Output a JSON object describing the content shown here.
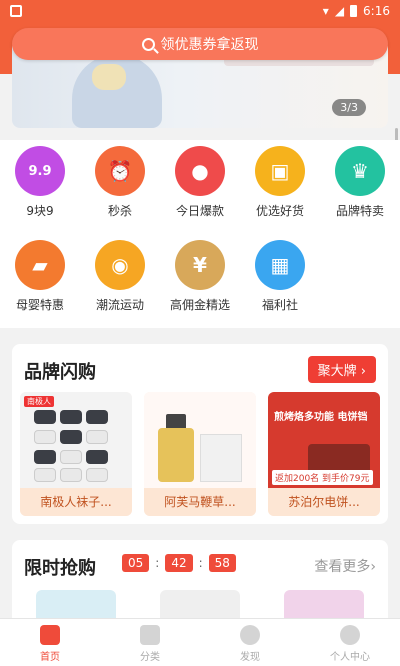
{
  "status_bar": {
    "time": "6:16"
  },
  "search": {
    "placeholder": "领优惠券拿返现"
  },
  "banner": {
    "pager": "3/3"
  },
  "categories": [
    {
      "label": "9块9",
      "icon": "nine-nine-icon",
      "color": "#c14de4",
      "glyph": "9.9"
    },
    {
      "label": "秒杀",
      "icon": "alarm-clock-icon",
      "color": "#f46a3c",
      "glyph": "⏰"
    },
    {
      "label": "今日爆款",
      "icon": "flame-icon",
      "color": "#ef4b4b",
      "glyph": "●"
    },
    {
      "label": "优选好货",
      "icon": "shopping-bag-icon",
      "color": "#f6b21c",
      "glyph": "▣"
    },
    {
      "label": "品牌特卖",
      "icon": "crown-icon",
      "color": "#23c2a0",
      "glyph": "♛"
    },
    {
      "label": "母婴特惠",
      "icon": "baby-bottle-icon",
      "color": "#f37a2f",
      "glyph": "▰"
    },
    {
      "label": "潮流运动",
      "icon": "basketball-icon",
      "color": "#f6a623",
      "glyph": "◉"
    },
    {
      "label": "高佣金精选",
      "icon": "money-bag-icon",
      "color": "#d8a85a",
      "glyph": "¥"
    },
    {
      "label": "福利社",
      "icon": "gift-box-icon",
      "color": "#3aa6f0",
      "glyph": "▦"
    }
  ],
  "brand_section": {
    "title": "品牌闪购",
    "more_button": "聚大牌 ›",
    "products": [
      {
        "name": "南极人袜子..."
      },
      {
        "name": "阿芙马鞭草..."
      },
      {
        "name": "苏泊尔电饼...",
        "image_text": "煎烤烙多功能 电饼铛",
        "tag": "返加200名 到手价79元"
      }
    ]
  },
  "flash_section": {
    "title": "限时抢购",
    "timer": {
      "hours": "05",
      "minutes": "42",
      "seconds": "58"
    },
    "more": "查看更多›"
  },
  "tab_bar": [
    {
      "label": "首页",
      "active": true
    },
    {
      "label": "分类",
      "active": false
    },
    {
      "label": "发现",
      "active": false
    },
    {
      "label": "个人中心",
      "active": false
    }
  ],
  "colors": {
    "primary": "#f2603a",
    "accent": "#ef3e34"
  }
}
